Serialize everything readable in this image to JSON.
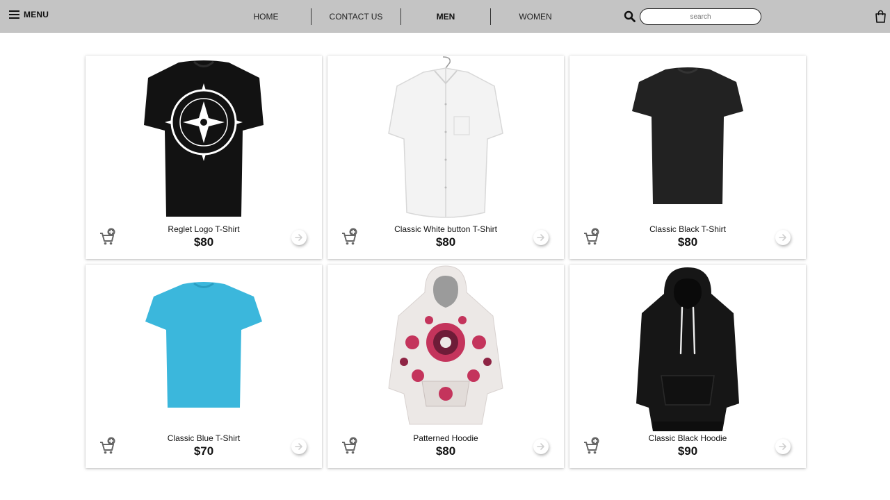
{
  "header": {
    "menu_label": "MENU",
    "nav": [
      {
        "label": "HOME",
        "active": false
      },
      {
        "label": "CONTACT US",
        "active": false
      },
      {
        "label": "MEN",
        "active": true
      },
      {
        "label": "WOMEN",
        "active": false
      }
    ],
    "search": {
      "placeholder": "search",
      "value": ""
    },
    "icons": {
      "menu": "hamburger-icon",
      "search": "search-icon",
      "cart": "shopping-bag-icon"
    }
  },
  "products": [
    {
      "name": "Reglet Logo T-Shirt",
      "price": "$80",
      "image": "black-logo-tshirt",
      "color": "#111111"
    },
    {
      "name": "Classic White button T-Shirt",
      "price": "$80",
      "image": "white-button-shirt",
      "color": "#f4f4f4"
    },
    {
      "name": "Classic Black T-Shirt",
      "price": "$80",
      "image": "black-tshirt",
      "color": "#1e1e1e"
    },
    {
      "name": "Classic Blue T-Shirt",
      "price": "$70",
      "image": "blue-tshirt",
      "color": "#3bb7dc"
    },
    {
      "name": "Patterned Hoodie",
      "price": "$80",
      "image": "patterned-hoodie",
      "color": "#c4345c"
    },
    {
      "name": "Classic Black Hoodie",
      "price": "$90",
      "image": "black-hoodie",
      "color": "#161616"
    }
  ],
  "card_icons": {
    "add_to_cart": "add-to-cart-icon",
    "details": "arrow-right-icon"
  }
}
